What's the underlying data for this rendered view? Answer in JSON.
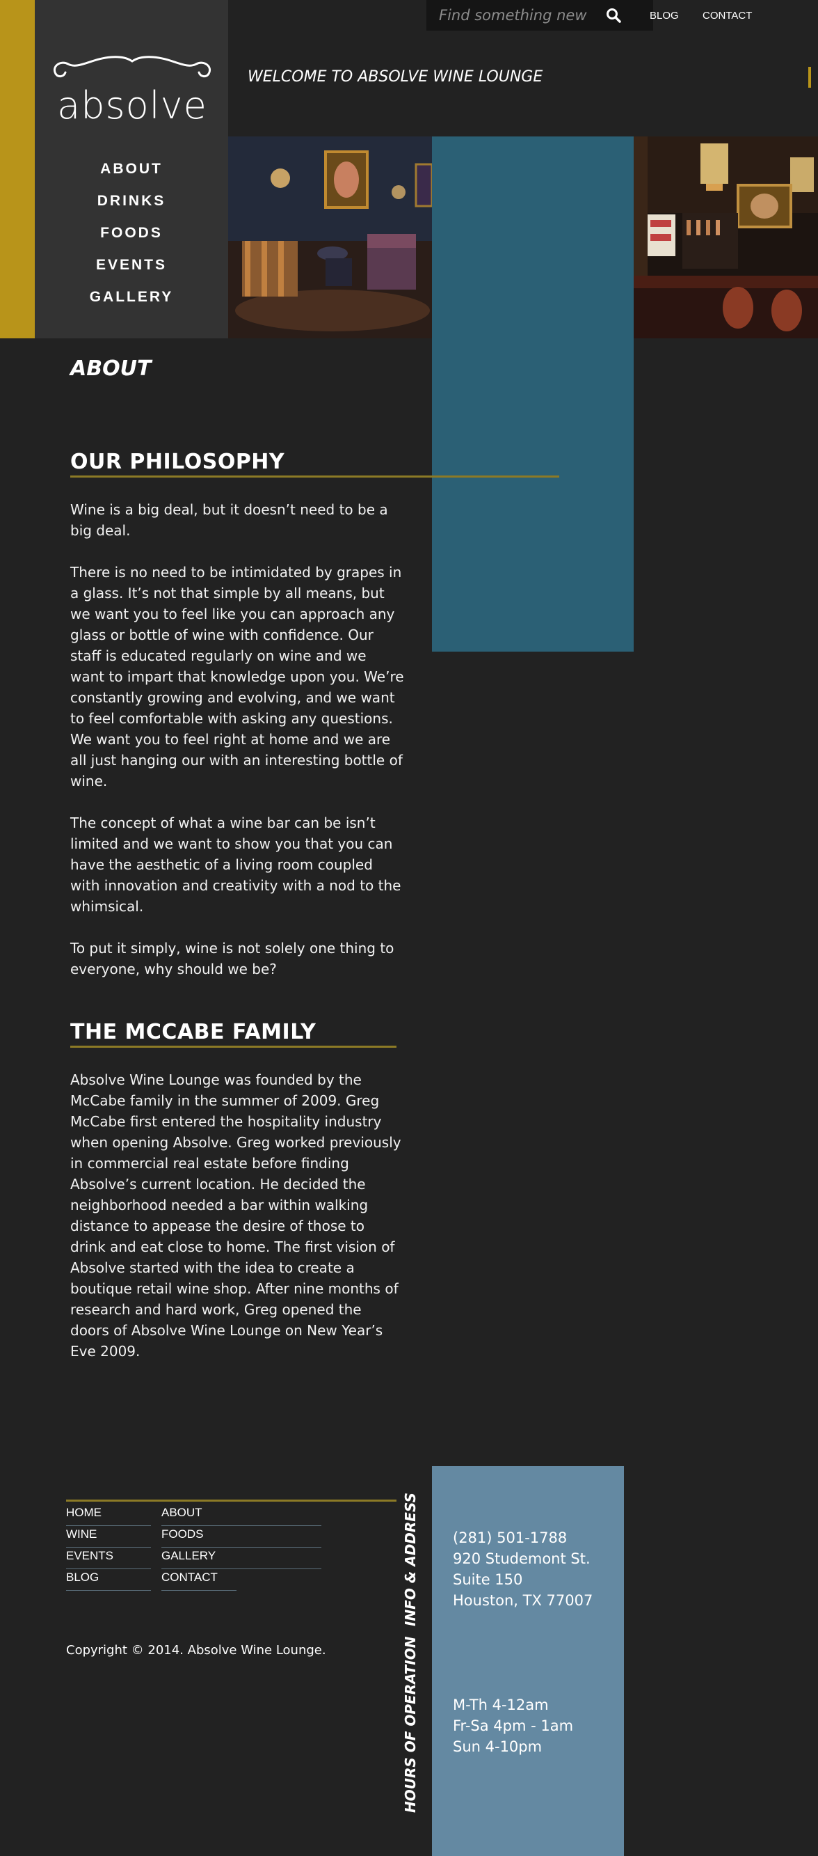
{
  "header": {
    "search_placeholder": "Find something new",
    "links": [
      "BLOG",
      "CONTACT"
    ],
    "welcome": "WELCOME TO ABSOLVE WINE LOUNGE"
  },
  "brand": {
    "logo_text": "absolve",
    "accent": "#b8941a",
    "panel_blue": "#2b6075",
    "info_blue": "#6489a2"
  },
  "nav": {
    "items": [
      "ABOUT",
      "DRINKS",
      "FOODS",
      "EVENTS",
      "GALLERY"
    ]
  },
  "page": {
    "title": "ABOUT",
    "philosophy": {
      "heading": "OUR PHILOSOPHY",
      "paragraphs": [
        "Wine is a big deal, but it doesn’t need to be a big deal.",
        "There is no need to be intimidated by grapes in a glass. It’s not that simple by all means, but we want you to feel like you can approach any glass or bottle of wine with confidence. Our staff is educated regularly on wine and we want to impart that knowledge upon you. We’re constantly growing and evolving, and we want to feel comfortable with asking any questions. We want you to feel right at home and we are all just hanging our with an interesting bottle of wine.",
        "The concept of what a wine bar can be isn’t limited and we want to show you that you can have the aesthetic of a living room coupled with innovation and creativity with a nod to the whimsical.",
        "To put it simply, wine is not solely one thing to everyone, why should we be?"
      ]
    },
    "family": {
      "heading": "THE MCCABE FAMILY",
      "paragraph": "Absolve Wine Lounge was founded by the McCabe family in the summer of 2009. Greg McCabe first entered the hospitality industry when opening Absolve. Greg worked previously in commercial real estate before finding Absolve’s current location. He decided the neighborhood needed a bar within walking distance to appease the desire of those to drink and eat close to home. The first vision of Absolve started with the idea to create a boutique retail wine shop. After nine months of research and hard work, Greg opened the doors of Absolve Wine Lounge on New Year’s Eve 2009."
    }
  },
  "footer": {
    "links_col1": [
      "HOME",
      "WINE",
      "EVENTS",
      "BLOG"
    ],
    "links_col2": [
      "ABOUT",
      "FOODS",
      "GALLERY",
      "CONTACT"
    ],
    "copyright": "Copyright © 2014. Absolve Wine Lounge.",
    "info_label": "INFO & ADDRESS",
    "hours_label": "HOURS OF OPERATION",
    "address_lines": [
      "(281) 501-1788",
      "920 Studemont St.",
      "Suite 150",
      "Houston, TX 77007"
    ],
    "hours_lines": [
      "M-Th 4-12am",
      "Fr-Sa 4pm - 1am",
      "Sun 4-10pm"
    ]
  }
}
